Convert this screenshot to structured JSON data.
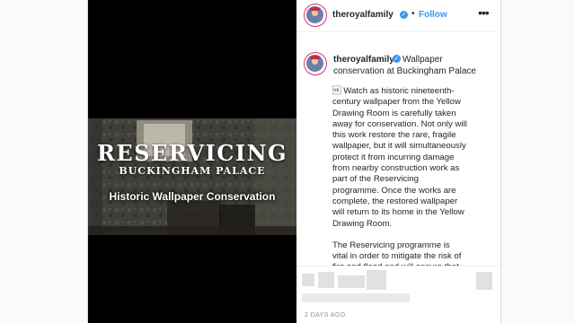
{
  "post": {
    "username": "theroyalfamily",
    "follow_label": "Follow",
    "separator": "•",
    "more_label": "•••",
    "verified_mark": "✓",
    "caption_title": "Wallpaper conservation at Buckingham Palace",
    "caption_paragraphs": [
      "\u001f Watch as historic nineteenth-century wallpaper from the Yellow Drawing Room is carefully taken away for conservation. Not only will this work restore the rare, fragile wallpaper, but it will simultaneously protect it from incurring damage from nearby construction work as part of the Reservicing programme. Once the works are complete, the restored wallpaper will return to its home in the Yellow Drawing Room.",
      "The Reservicing programme is vital in order to mitigate the risk of fire and flood and will ensure that old wiring is brought in line with current health"
    ],
    "timestamp": "2 DAYS AGO"
  },
  "media": {
    "title": "RESERVICING",
    "subtitle": "BUCKINGHAM PALACE",
    "caption": "Historic Wallpaper Conservation"
  },
  "icons": {
    "avatar": "royal-family-avatar",
    "verified": "verified-badge-icon",
    "more": "more-options-icon"
  },
  "colors": {
    "accent": "#3897f0",
    "text": "#262626",
    "muted": "#8e8e8e",
    "border": "#dbdbdb",
    "story_ring": "#e1306c"
  }
}
